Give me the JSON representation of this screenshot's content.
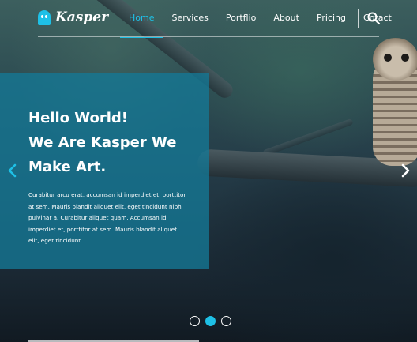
{
  "brand": {
    "name": "Kasper",
    "accent": "#1ec0e6"
  },
  "nav": {
    "items": [
      {
        "label": "Home",
        "active": true
      },
      {
        "label": "Services"
      },
      {
        "label": "Portflio"
      },
      {
        "label": "About"
      },
      {
        "label": "Pricing"
      },
      {
        "label": "Cotact"
      }
    ],
    "search_icon": "search-icon"
  },
  "slide": {
    "headline": [
      "Hello World!",
      "We Are Kasper We",
      "Make Art."
    ],
    "paragraph": "Curabitur arcu erat, accumsan id imperdiet et, porttitor at sem. Mauris blandit aliquet elit, eget tincidunt nibh pulvinar a. Curabitur aliquet quam. Accumsan id imperdiet et, porttitor at sem. Mauris blandit aliquet elit, eget tincidunt.",
    "overlay_color": "#1478a0"
  },
  "slider": {
    "prev_icon": "chevron-left-icon",
    "next_icon": "chevron-right-icon",
    "dots": 3,
    "active_dot": 2
  }
}
